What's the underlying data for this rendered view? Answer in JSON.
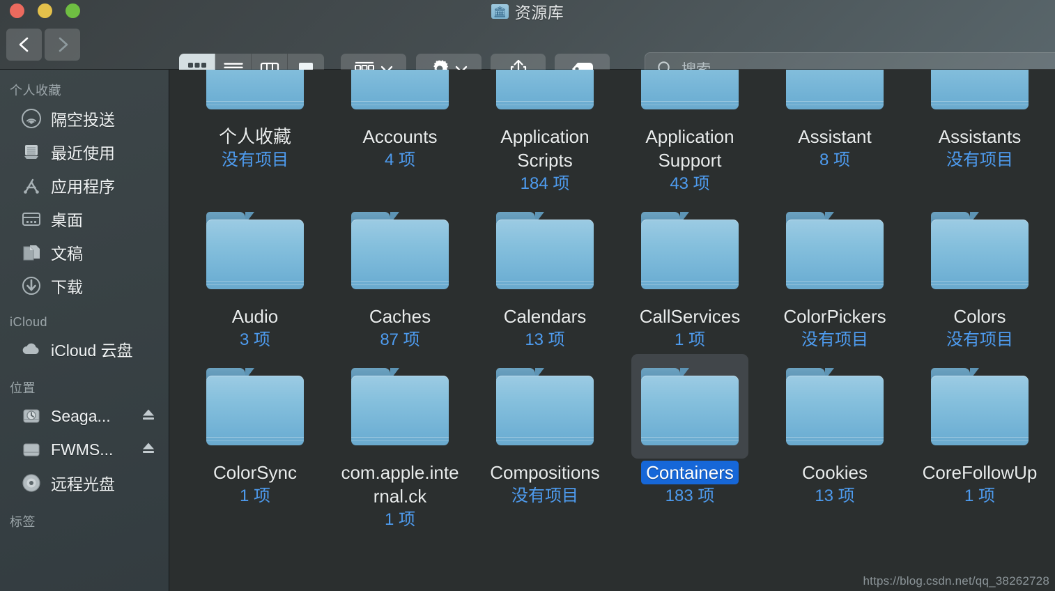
{
  "window": {
    "title": "资源库",
    "title_icon": "library-folder-icon",
    "traffic_lights": [
      {
        "name": "close",
        "color": "#ec6a5e"
      },
      {
        "name": "minimize",
        "color": "#e4c14b"
      },
      {
        "name": "zoom",
        "color": "#6fbe42"
      }
    ]
  },
  "toolbar": {
    "back_icon": "chevron-left-icon",
    "forward_icon": "chevron-right-icon",
    "view_modes": [
      {
        "name": "icon-view",
        "icon": "grid-icon",
        "active": true
      },
      {
        "name": "list-view",
        "icon": "list-icon",
        "active": false
      },
      {
        "name": "column-view",
        "icon": "columns-icon",
        "active": false
      },
      {
        "name": "gallery-view",
        "icon": "gallery-icon",
        "active": false
      }
    ],
    "arrange_icon": "group-icon",
    "arrange_chevron": "chevron-down-icon",
    "action_icon": "gear-icon",
    "action_chevron": "chevron-down-icon",
    "share_icon": "share-icon",
    "tags_icon": "tag-icon"
  },
  "search": {
    "icon": "search-icon",
    "placeholder": "搜索",
    "value": ""
  },
  "sidebar": {
    "sections": [
      {
        "header": "个人收藏",
        "items": [
          {
            "label": "隔空投送",
            "icon": "airdrop-icon",
            "eject": false
          },
          {
            "label": "最近使用",
            "icon": "recents-icon",
            "eject": false
          },
          {
            "label": "应用程序",
            "icon": "applications-icon",
            "eject": false
          },
          {
            "label": "桌面",
            "icon": "desktop-icon",
            "eject": false
          },
          {
            "label": "文稿",
            "icon": "documents-icon",
            "eject": false
          },
          {
            "label": "下载",
            "icon": "downloads-icon",
            "eject": false
          }
        ]
      },
      {
        "header": "iCloud",
        "items": [
          {
            "label": "iCloud 云盘",
            "icon": "cloud-icon",
            "eject": false
          }
        ]
      },
      {
        "header": "位置",
        "items": [
          {
            "label": "Seaga...",
            "icon": "time-machine-disk-icon",
            "eject": true
          },
          {
            "label": "FWMS...",
            "icon": "hard-disk-icon",
            "eject": true
          },
          {
            "label": "远程光盘",
            "icon": "optical-disc-icon",
            "eject": false
          }
        ]
      },
      {
        "header": "标签",
        "items": []
      }
    ]
  },
  "content": {
    "rows": [
      [
        {
          "name": "个人收藏",
          "count": "没有项目",
          "selected": false
        },
        {
          "name": "Accounts",
          "count": "4 项",
          "selected": false
        },
        {
          "name": "Application Scripts",
          "count": "184 项",
          "selected": false
        },
        {
          "name": "Application Support",
          "count": "43 项",
          "selected": false
        },
        {
          "name": "Assistant",
          "count": "8 项",
          "selected": false
        },
        {
          "name": "Assistants",
          "count": "没有项目",
          "selected": false
        }
      ],
      [
        {
          "name": "Audio",
          "count": "3 项",
          "selected": false
        },
        {
          "name": "Caches",
          "count": "87 项",
          "selected": false
        },
        {
          "name": "Calendars",
          "count": "13 项",
          "selected": false
        },
        {
          "name": "CallServices",
          "count": "1 项",
          "selected": false
        },
        {
          "name": "ColorPickers",
          "count": "没有项目",
          "selected": false
        },
        {
          "name": "Colors",
          "count": "没有项目",
          "selected": false
        }
      ],
      [
        {
          "name": "ColorSync",
          "count": "1 项",
          "selected": false
        },
        {
          "name": "com.apple.internal.ck",
          "count": "1 项",
          "selected": false
        },
        {
          "name": "Compositions",
          "count": "没有项目",
          "selected": false
        },
        {
          "name": "Containers",
          "count": "183 项",
          "selected": true
        },
        {
          "name": "Cookies",
          "count": "13 项",
          "selected": false
        },
        {
          "name": "CoreFollowUp",
          "count": "1 项",
          "selected": false
        }
      ]
    ]
  },
  "watermark": "https://blog.csdn.net/qq_38262728",
  "colors": {
    "accent_blue": "#1667d8",
    "count_blue": "#4e9cf0",
    "content_bg": "#2b2f2f",
    "folder_blue": "#86c0dd"
  }
}
